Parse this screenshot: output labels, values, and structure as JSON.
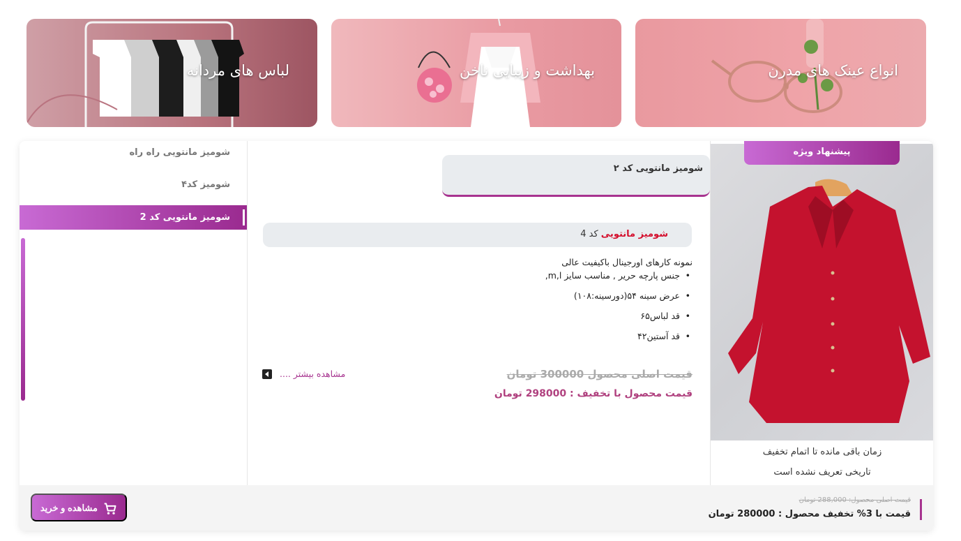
{
  "banners": [
    {
      "title": "انواع عینک های مدرن"
    },
    {
      "title": "بهداشت و زیبایی ناخن"
    },
    {
      "title": "لباس های مردانه"
    }
  ],
  "special_offer": {
    "badge": "پیشنهاد ویژه",
    "timer_label": "زمان باقی مانده تا اتمام تخفیف",
    "timer_value": "تاریخی تعریف نشده است"
  },
  "product": {
    "title": "شومیز مانتویی کد ۲",
    "sub_name_highlight": "شومیز مانتویی",
    "sub_name_rest": " کد 4",
    "description_lead": "نمونه کارهای اورجینال باکیفیت عالی",
    "features": [
      "جنس پارچه حریر , مناسب سایز m,l,",
      "عرض سینه ۵۴(دورسینه:۱۰۸)",
      "قد لباس۶۵",
      "قد آستین۴۲"
    ],
    "price_original": "قیمت اصلی محصول 300000 تومان",
    "price_discounted": "قیمت محصول با تخفیف : 298000 تومان",
    "more_link": "مشاهده بیشتر ...."
  },
  "product_list": [
    {
      "label": "شومیز مانتویی راه راه"
    },
    {
      "label": "شومیز کد۴"
    },
    {
      "label": "شومیز مانتویی کد 2"
    }
  ],
  "footer": {
    "price_original": "قیمت اصلی محصول: 288,000 تومان",
    "price_discounted": "قیمت با 3% تخفیف محصول : 280000 تومان",
    "buy_button": "مشاهده و خرید"
  },
  "colors": {
    "accent": "#a7338f",
    "accent_light": "#c86ad4",
    "highlight_red": "#d40f2d"
  }
}
